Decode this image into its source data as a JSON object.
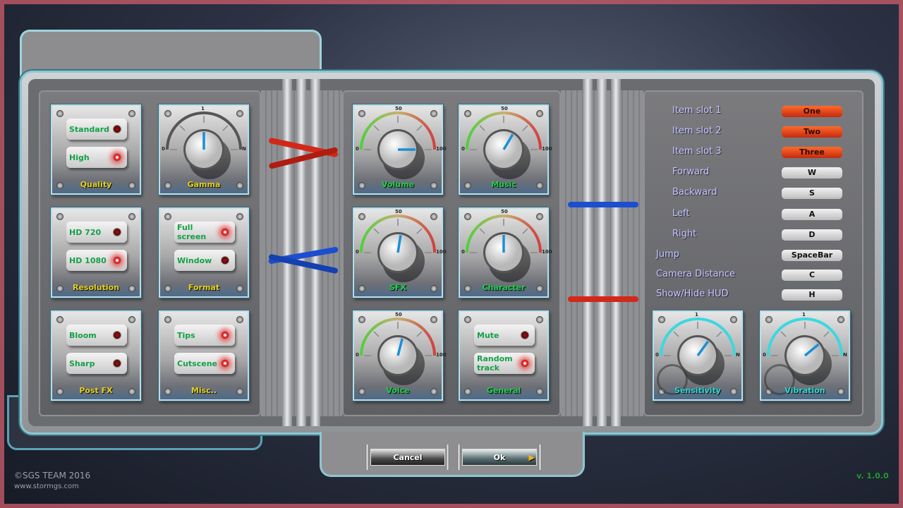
{
  "graphics": {
    "quality": {
      "label": "Quality",
      "options": [
        {
          "label": "Standard",
          "on": false
        },
        {
          "label": "High",
          "on": true
        }
      ]
    },
    "gamma": {
      "label": "Gamma",
      "scale": [
        "0",
        "1",
        "N"
      ],
      "value": 0.5
    },
    "resolution": {
      "label": "Resolution",
      "options": [
        {
          "label": "HD 720",
          "on": false
        },
        {
          "label": "HD 1080",
          "on": true
        }
      ]
    },
    "format": {
      "label": "Format",
      "options": [
        {
          "label": "Full screen",
          "on": true
        },
        {
          "label": "Window",
          "on": false
        }
      ]
    },
    "postfx": {
      "label": "Post FX",
      "options": [
        {
          "label": "Bloom",
          "on": false
        },
        {
          "label": "Sharp",
          "on": false
        }
      ]
    },
    "misc": {
      "label": "Misc..",
      "options": [
        {
          "label": "Tips",
          "on": true
        },
        {
          "label": "Cutscene",
          "on": true
        }
      ]
    }
  },
  "audio": {
    "scale": [
      "0",
      "50",
      "100"
    ],
    "volume": {
      "label": "Volume",
      "value": 100
    },
    "music": {
      "label": "Music",
      "value": 67
    },
    "sfx": {
      "label": "SFX",
      "value": 55
    },
    "character": {
      "label": "Character",
      "value": 50
    },
    "voice": {
      "label": "Voice",
      "value": 58
    },
    "general": {
      "label": "General",
      "options": [
        {
          "label": "Mute",
          "on": false
        },
        {
          "label": "Random track",
          "on": true
        }
      ]
    }
  },
  "controls": {
    "bindings": [
      {
        "label": "Item slot 1",
        "key": "One",
        "highlight": true
      },
      {
        "label": "Item slot 2",
        "key": "Two",
        "highlight": true
      },
      {
        "label": "Item slot 3",
        "key": "Three",
        "highlight": true
      },
      {
        "label": "Forward",
        "key": "W"
      },
      {
        "label": "Backward",
        "key": "S"
      },
      {
        "label": "Left",
        "key": "A"
      },
      {
        "label": "Right",
        "key": "D"
      },
      {
        "label": "Jump",
        "key": "SpaceBar"
      },
      {
        "label": "Camera Distance",
        "key": "C"
      },
      {
        "label": "Show/Hide HUD",
        "key": "H"
      }
    ],
    "sensitivity": {
      "label": "Sensitivity",
      "scale": [
        "0",
        "1",
        "N"
      ],
      "value": 0.7,
      "icon": "mouse-icon"
    },
    "vibration": {
      "label": "Vibration",
      "scale": [
        "0",
        "1",
        "N"
      ],
      "value": 0.78,
      "icon": "gamepad-icon"
    }
  },
  "dialog": {
    "cancel": "Cancel",
    "ok": "Ok"
  },
  "footer": {
    "copyright": "©SGS TEAM 2016",
    "website": "www.stormgs.com",
    "version": "v. 1.0.0"
  },
  "colors": {
    "toggle_text": "#14a147",
    "led_on": "#ff2a2a",
    "graphics_label": "#e8d21c",
    "audio_label": "#1fd24a",
    "control_label": "#2fd8d4",
    "key_highlight": "#e8481c",
    "pointer": "#1a8fd8"
  }
}
